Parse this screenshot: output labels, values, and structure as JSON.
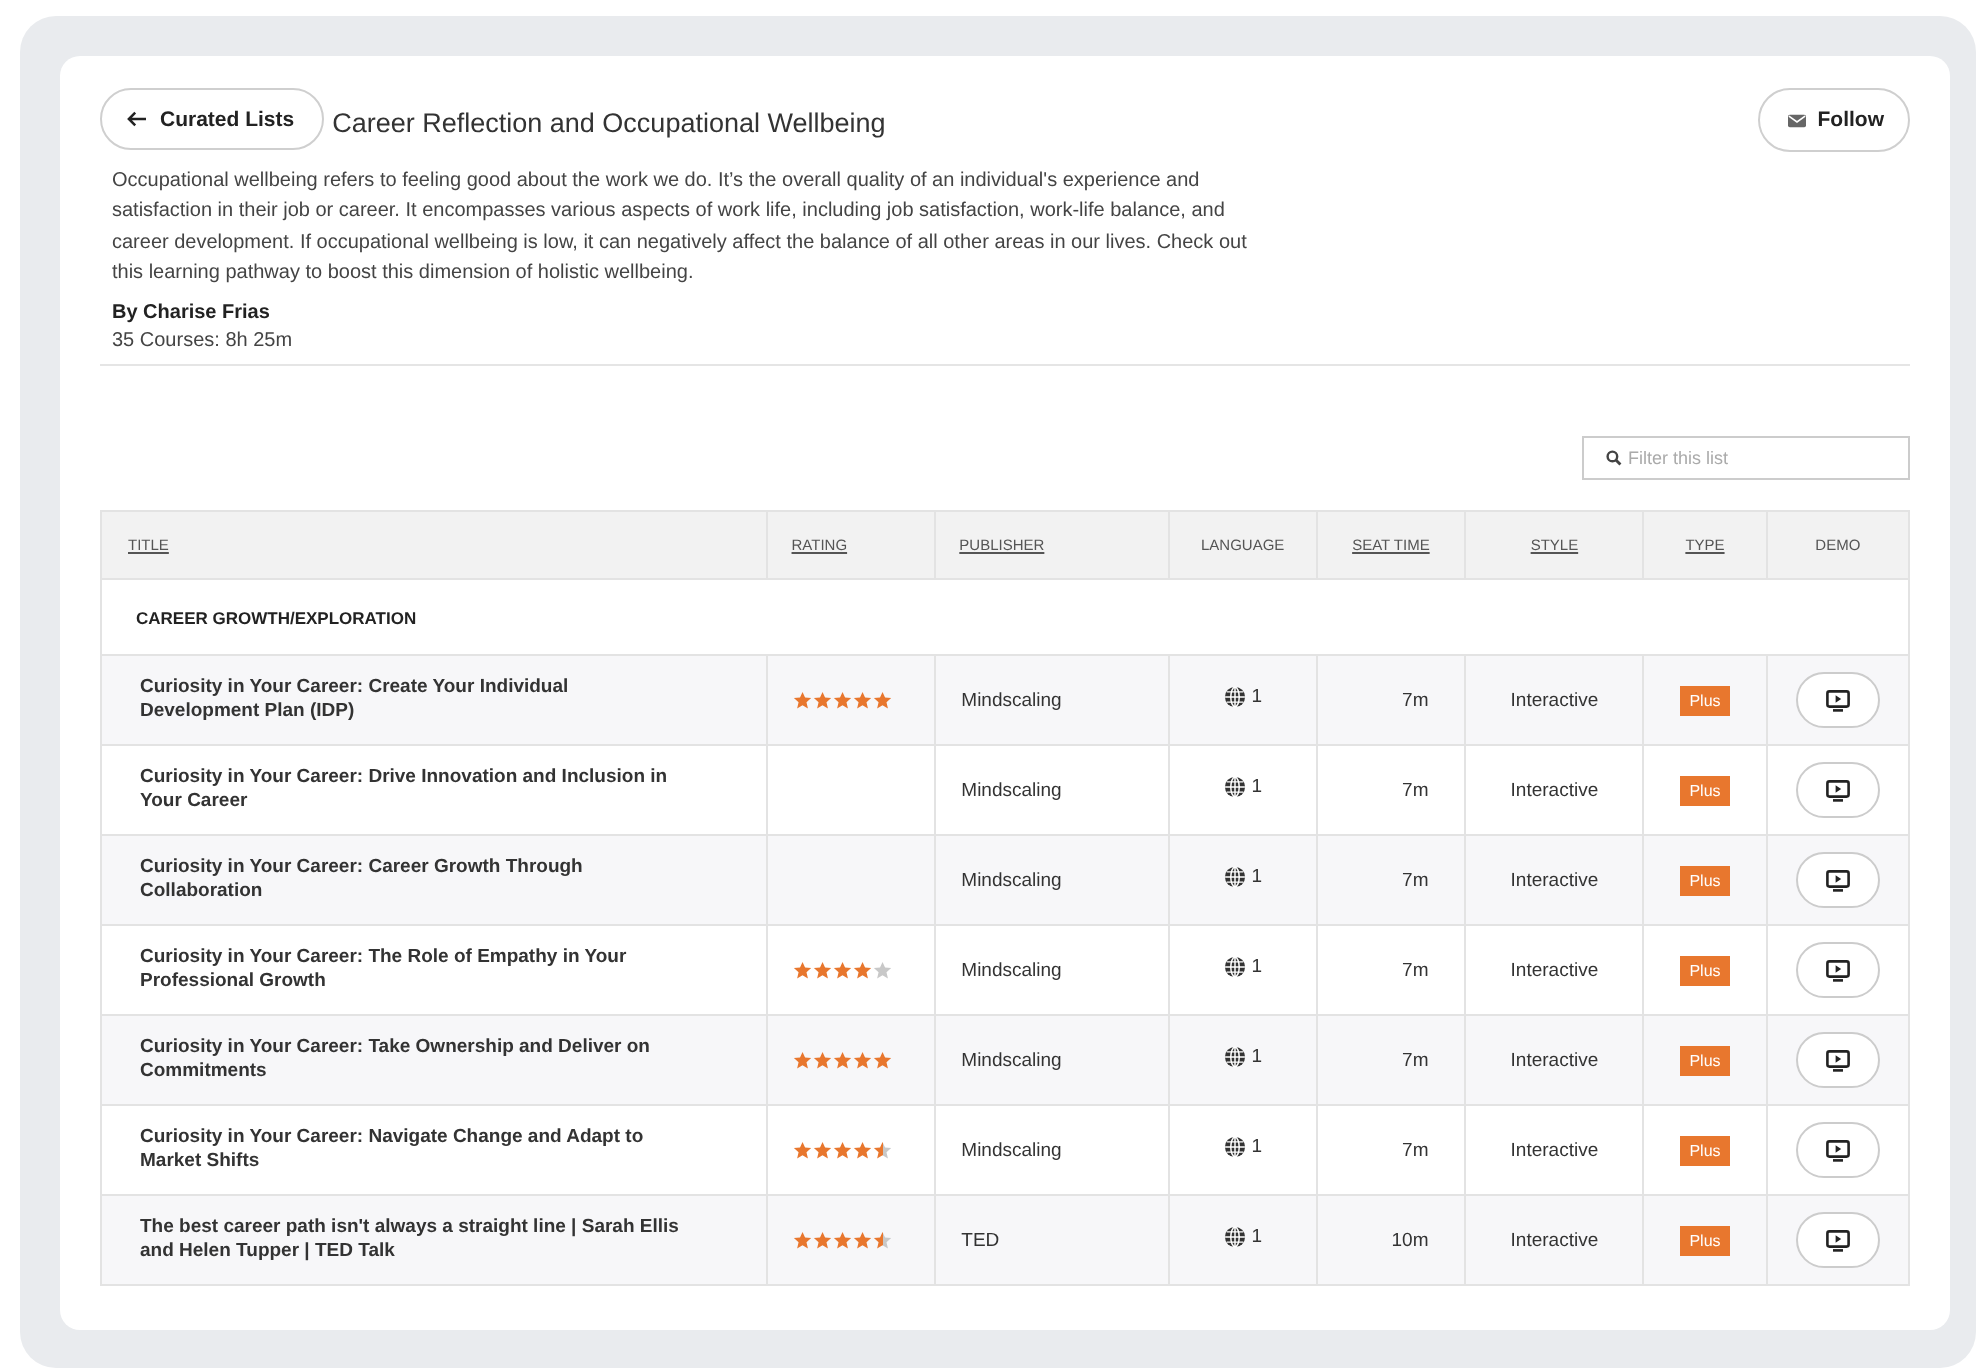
{
  "back_button": {
    "label": "Curated Lists"
  },
  "title": "Career Reflection and Occupational Wellbeing",
  "follow_button": {
    "label": "Follow"
  },
  "description": "Occupational wellbeing refers to feeling good about the work we do. It’s the overall quality of an individual's experience and satisfaction in their job or career. It encompasses various aspects of work life, including job satisfaction, work-life balance, and career development. If occupational wellbeing is low, it can negatively affect the balance of all other areas in our lives. Check out this learning pathway to boost this dimension of holistic wellbeing.",
  "author": "By Charise Frias",
  "summary": "35 Courses: 8h 25m",
  "filter": {
    "placeholder": "Filter this list"
  },
  "table": {
    "columns": [
      {
        "label": "TITLE",
        "sortable": true
      },
      {
        "label": "RATING",
        "sortable": true
      },
      {
        "label": "PUBLISHER",
        "sortable": true
      },
      {
        "label": "LANGUAGE",
        "sortable": false
      },
      {
        "label": "SEAT TIME",
        "sortable": true
      },
      {
        "label": "STYLE",
        "sortable": true
      },
      {
        "label": "TYPE",
        "sortable": true
      },
      {
        "label": "DEMO",
        "sortable": false
      }
    ],
    "group": "CAREER GROWTH/EXPLORATION",
    "rows": [
      {
        "title": "Curiosity in Your Career: Create Your Individual Development Plan (IDP)",
        "stars": 5,
        "publisher": "Mindscaling",
        "languages": "1",
        "seat_time": "7m",
        "style": "Interactive",
        "type": "Plus"
      },
      {
        "title": "Curiosity in Your Career: Drive Innovation and Inclusion in Your Career",
        "publisher": "Mindscaling",
        "languages": "1",
        "seat_time": "7m",
        "style": "Interactive",
        "type": "Plus"
      },
      {
        "title": "Curiosity in Your Career: Career Growth Through Collaboration",
        "publisher": "Mindscaling",
        "languages": "1",
        "seat_time": "7m",
        "style": "Interactive",
        "type": "Plus"
      },
      {
        "title": "Curiosity in Your Career: The Role of Empathy in Your Professional Growth",
        "stars": 4,
        "publisher": "Mindscaling",
        "languages": "1",
        "seat_time": "7m",
        "style": "Interactive",
        "type": "Plus"
      },
      {
        "title": "Curiosity in Your Career: Take Ownership and Deliver on Commitments",
        "stars": 5,
        "publisher": "Mindscaling",
        "languages": "1",
        "seat_time": "7m",
        "style": "Interactive",
        "type": "Plus"
      },
      {
        "title": "Curiosity in Your Career: Navigate Change and Adapt to Market Shifts",
        "stars": 4.5,
        "publisher": "Mindscaling",
        "languages": "1",
        "seat_time": "7m",
        "style": "Interactive",
        "type": "Plus"
      },
      {
        "title": "The best career path isn't always a straight line | Sarah Ellis and Helen Tupper | TED Talk",
        "stars": 4.5,
        "publisher": "TED",
        "languages": "1",
        "seat_time": "10m",
        "style": "Interactive",
        "type": "Plus"
      }
    ]
  }
}
